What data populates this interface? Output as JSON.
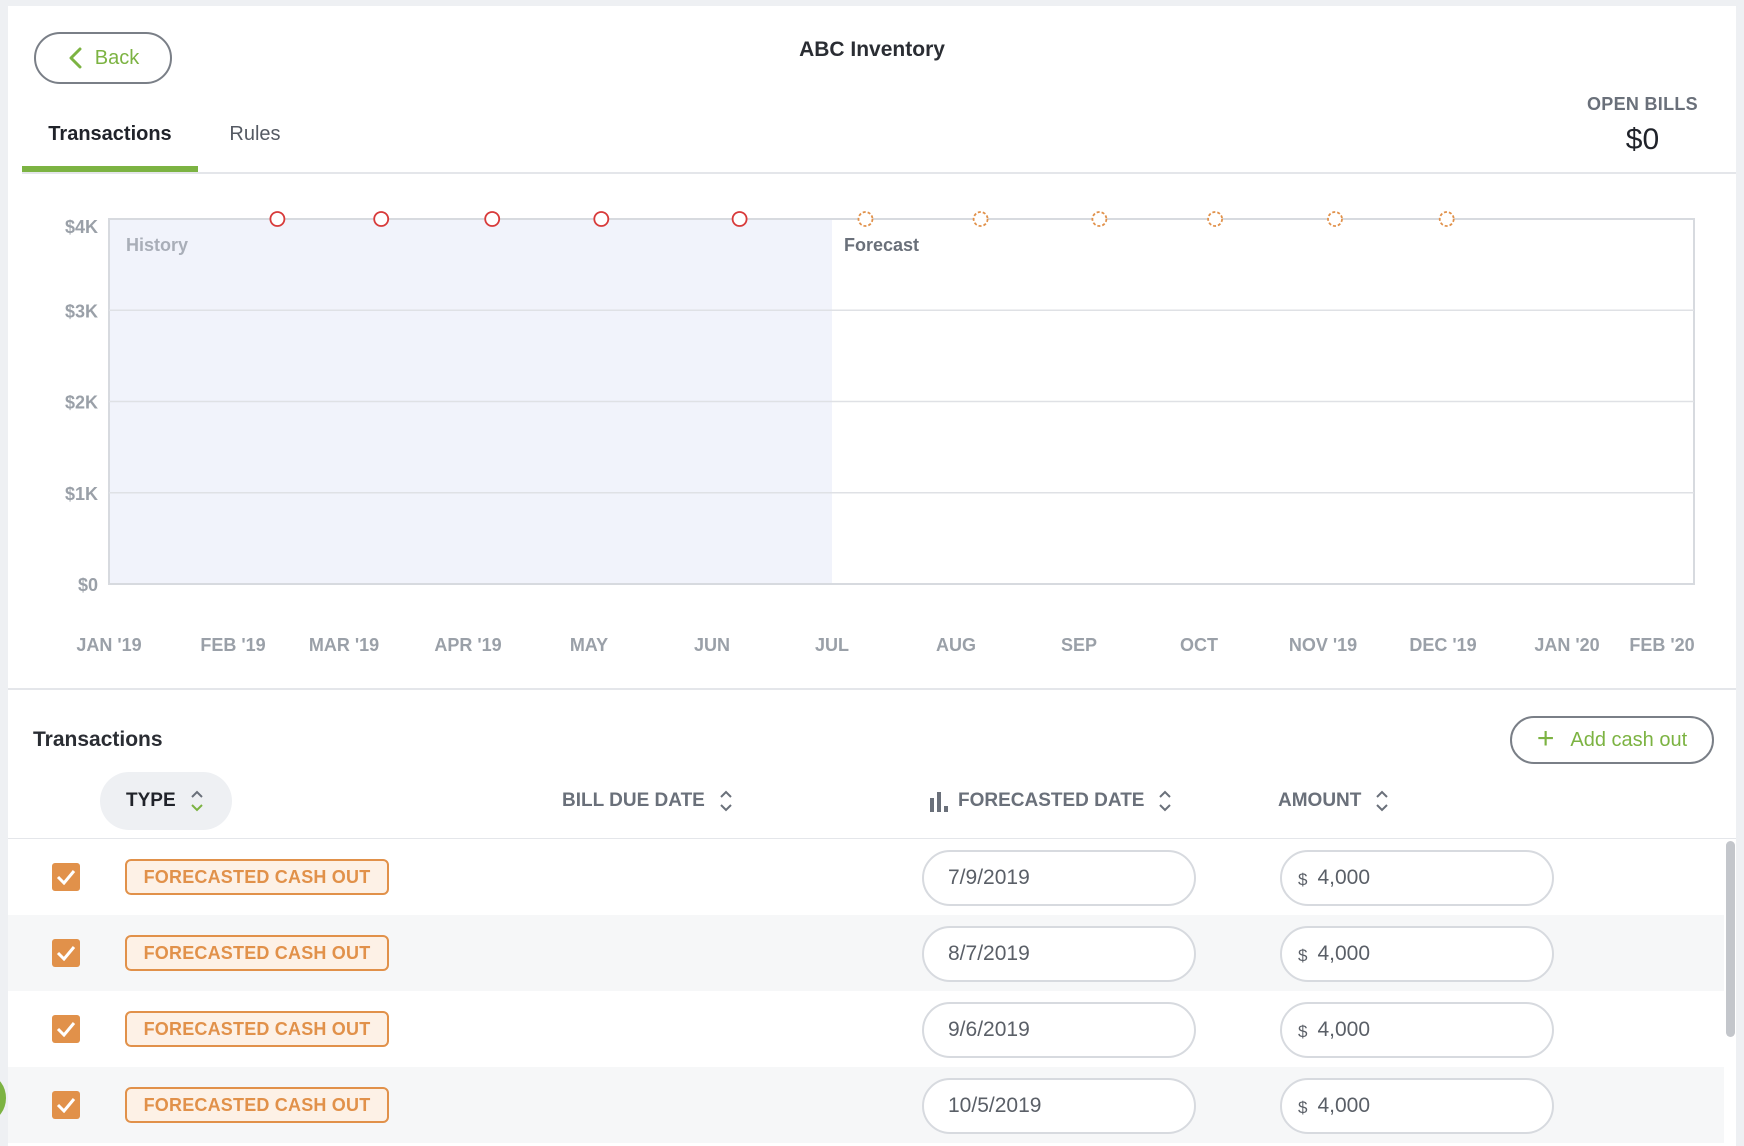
{
  "header": {
    "back_label": "Back",
    "title": "ABC Inventory",
    "tabs": [
      {
        "label": "Transactions",
        "active": true
      },
      {
        "label": "Rules",
        "active": false
      }
    ],
    "open_bills_label": "OPEN BILLS",
    "open_bills_value": "$0"
  },
  "colors": {
    "accent_green": "#7cb342",
    "history_fill": "#f1f3fb",
    "history_marker": "#d83a3a",
    "forecast_marker": "#e1914a",
    "badge_orange": "#e1914a"
  },
  "chart_data": {
    "type": "scatter",
    "x_labels": [
      "JAN '19",
      "FEB '19",
      "MAR '19",
      "APR '19",
      "MAY",
      "JUN",
      "JUL",
      "AUG",
      "SEP",
      "OCT",
      "NOV '19",
      "DEC '19",
      "JAN '20",
      "FEB '20"
    ],
    "y_ticks": [
      "$0",
      "$1K",
      "$2K",
      "$3K",
      "$4K"
    ],
    "ylim": [
      0,
      4000
    ],
    "region_labels": {
      "history": "History",
      "forecast": "Forecast"
    },
    "history_end_month": 6,
    "grid": true,
    "series": [
      {
        "kind": "history",
        "points": [
          {
            "month": 1.4,
            "value": 4000
          },
          {
            "month": 2.3,
            "value": 4000
          },
          {
            "month": 3.2,
            "value": 4000
          },
          {
            "month": 4.1,
            "value": 4000
          },
          {
            "month": 5.23,
            "value": 4000
          }
        ]
      },
      {
        "kind": "forecast",
        "points": [
          {
            "month": 6.27,
            "value": 4000
          },
          {
            "month": 7.2,
            "value": 4000
          },
          {
            "month": 8.17,
            "value": 4000
          },
          {
            "month": 9.13,
            "value": 4000
          },
          {
            "month": 10.1,
            "value": 4000
          },
          {
            "month": 11.03,
            "value": 4000
          }
        ]
      }
    ]
  },
  "transactions": {
    "title": "Transactions",
    "add_label": "Add cash out",
    "columns": {
      "type": "TYPE",
      "bill_due": "BILL DUE DATE",
      "forecasted": "FORECASTED DATE",
      "amount": "AMOUNT"
    },
    "rows": [
      {
        "checked": true,
        "type": "FORECASTED CASH OUT",
        "forecasted_date": "7/9/2019",
        "currency": "$",
        "amount": "4,000"
      },
      {
        "checked": true,
        "type": "FORECASTED CASH OUT",
        "forecasted_date": "8/7/2019",
        "currency": "$",
        "amount": "4,000"
      },
      {
        "checked": true,
        "type": "FORECASTED CASH OUT",
        "forecasted_date": "9/6/2019",
        "currency": "$",
        "amount": "4,000"
      },
      {
        "checked": true,
        "type": "FORECASTED CASH OUT",
        "forecasted_date": "10/5/2019",
        "currency": "$",
        "amount": "4,000"
      }
    ]
  }
}
